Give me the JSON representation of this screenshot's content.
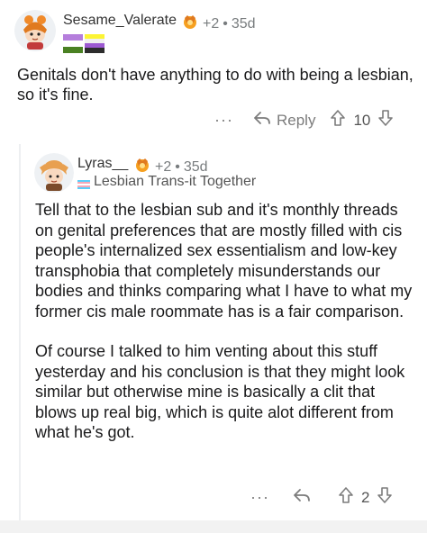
{
  "comments": [
    {
      "username": "Sesame_Valerate",
      "award_count": "+2",
      "separator": "•",
      "age": "35d",
      "body": "Genitals don't have anything to do with being a lesbian, so it's fine.",
      "actions": {
        "more": "···",
        "reply_label": "Reply",
        "score": "10"
      }
    },
    {
      "username": "Lyras__",
      "award_count": "+2",
      "separator": "•",
      "age": "35d",
      "flair": "Lesbian Trans-it Together",
      "paragraphs": [
        "Tell that to the lesbian sub and it's monthly threads on genital preferences that are mostly filled with cis people's internalized sex essentialism and low-key transphobia that completely misunderstands our bodies and thinks comparing what I have to what my former cis male roommate has is a fair comparison.",
        "Of course I talked to him venting about this stuff yesterday and his conclusion is that they might look similar but otherwise mine is basically a clit that blows up real big, which is quite alot different from what he's got."
      ],
      "actions": {
        "more": "···",
        "score": "2"
      }
    }
  ],
  "colors": {
    "meta_gray": "#787c7e",
    "award_orange": "#e07a1f",
    "genderqueer_flag": [
      "#b57edc",
      "#ffffff",
      "#4a8123"
    ],
    "nonbinary_flag": [
      "#fcf434",
      "#ffffff",
      "#9c59d1",
      "#2c2c2c"
    ],
    "trans_flag": [
      "#5bcefa",
      "#f5a9b8",
      "#ffffff"
    ]
  },
  "icons": [
    "avatar-snoo",
    "award-icon",
    "reply-arrow-icon",
    "upvote-icon",
    "downvote-icon",
    "more-dots-icon"
  ]
}
